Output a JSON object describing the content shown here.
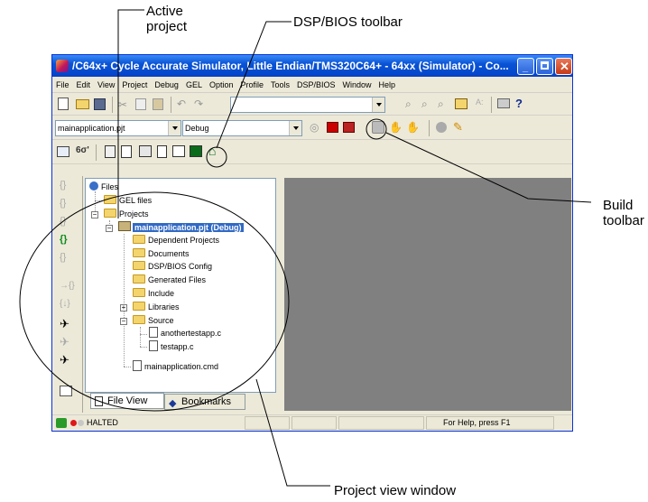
{
  "callouts": {
    "active_project": "Active\nproject",
    "dsp_bios_toolbar": "DSP/BIOS toolbar",
    "build_toolbar": "Build\ntoolbar",
    "project_view_window": "Project view  window"
  },
  "window": {
    "title": "/C64x+ Cycle Accurate Simulator, Little Endian/TMS320C64+ - 64xx (Simulator) - Co...",
    "titlebar_color": "#0a53d6"
  },
  "menu": [
    "File",
    "Edit",
    "View",
    "Project",
    "Debug",
    "GEL",
    "Option",
    "Profile",
    "Tools",
    "DSP/BIOS",
    "Window",
    "Help"
  ],
  "project_combo": {
    "value": "mainapplication.pjt"
  },
  "config_combo": {
    "value": "Debug"
  },
  "tree": {
    "root": "Files",
    "gel": "GEL files",
    "projects": "Projects",
    "active_project": "mainapplication.pjt (Debug)",
    "dependent": "Dependent Projects",
    "documents": "Documents",
    "dspbios": "DSP/BIOS Config",
    "generated": "Generated Files",
    "include": "Include",
    "libraries": "Libraries",
    "source": "Source",
    "file1": "anothertestapp.c",
    "file2": "testapp.c",
    "cmd": "mainapplication.cmd"
  },
  "tabs": {
    "file_view": "File View",
    "bookmarks": "Bookmarks"
  },
  "status": {
    "state": "HALTED",
    "help": "For Help, press F1"
  },
  "icons": [
    "app-icon",
    "minimize-icon",
    "maximize-icon",
    "close-icon",
    "new-file-icon",
    "open-icon",
    "save-icon",
    "cut-icon",
    "copy-icon",
    "paste-icon",
    "undo-icon",
    "redo-icon",
    "find-icon",
    "print-icon",
    "help-icon",
    "build-icon",
    "halt-build-icon",
    "dsp-bios-icon",
    "step-into-icon",
    "run-icon",
    "folder-icon",
    "file-icon"
  ]
}
